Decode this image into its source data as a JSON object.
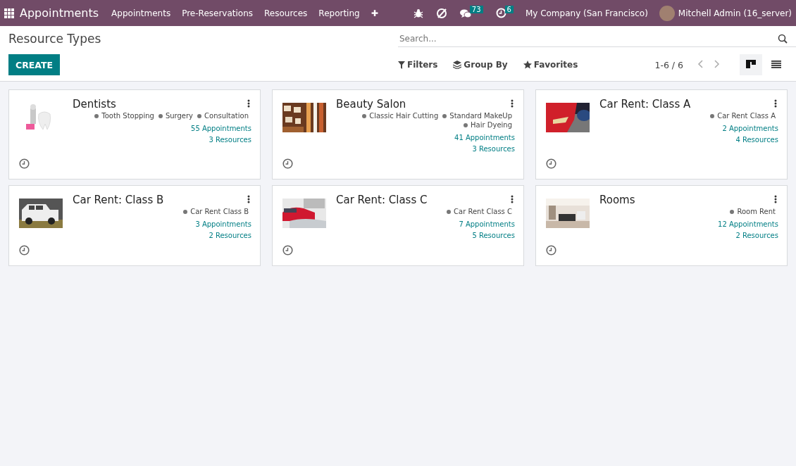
{
  "navbar": {
    "app_title": "Appointments",
    "menu": [
      "Appointments",
      "Pre-Reservations",
      "Resources",
      "Reporting"
    ],
    "add": "✚",
    "messages_count": "73",
    "activities_count": "6",
    "company": "My Company (San Francisco)",
    "user": "Mitchell Admin (16_server)"
  },
  "control_panel": {
    "title": "Resource Types",
    "create": "CREATE",
    "search": {
      "placeholder": "Search..."
    },
    "filters": "Filters",
    "group_by": "Group By",
    "favorites": "Favorites",
    "pager": "1-6 / 6",
    "views": [
      {
        "kind": "kanban",
        "selected": true
      },
      {
        "kind": "list",
        "selected": false
      }
    ]
  },
  "cards": [
    {
      "title": "Dentists",
      "image": {
        "kind": "picture"
      },
      "tags": [
        "Tooth Stopping",
        "Surgery",
        "Consultation"
      ],
      "appointments": "55 Appointments",
      "resources": "3 Resources"
    },
    {
      "title": "Beauty Salon",
      "image": {
        "kind": "picture"
      },
      "tags": [
        "Classic Hair Cutting",
        "Standard MakeUp",
        "Hair Dyeing"
      ],
      "appointments": "41 Appointments",
      "resources": "3 Resources"
    },
    {
      "title": "Car Rent: Class A",
      "image": {
        "kind": "picture"
      },
      "tags": [
        "Car Rent Class A"
      ],
      "appointments": "2 Appointments",
      "resources": "4 Resources"
    },
    {
      "title": "Car Rent: Class B",
      "image": {
        "kind": "picture"
      },
      "tags": [
        "Car Rent Class B"
      ],
      "appointments": "3 Appointments",
      "resources": "2 Resources"
    },
    {
      "title": "Car Rent: Class C",
      "image": {
        "kind": "picture"
      },
      "tags": [
        "Car Rent Class C"
      ],
      "appointments": "7 Appointments",
      "resources": "5 Resources"
    },
    {
      "title": "Rooms",
      "image": {
        "kind": "picture"
      },
      "tags": [
        "Room Rent"
      ],
      "appointments": "12 Appointments",
      "resources": "2 Resources"
    }
  ]
}
